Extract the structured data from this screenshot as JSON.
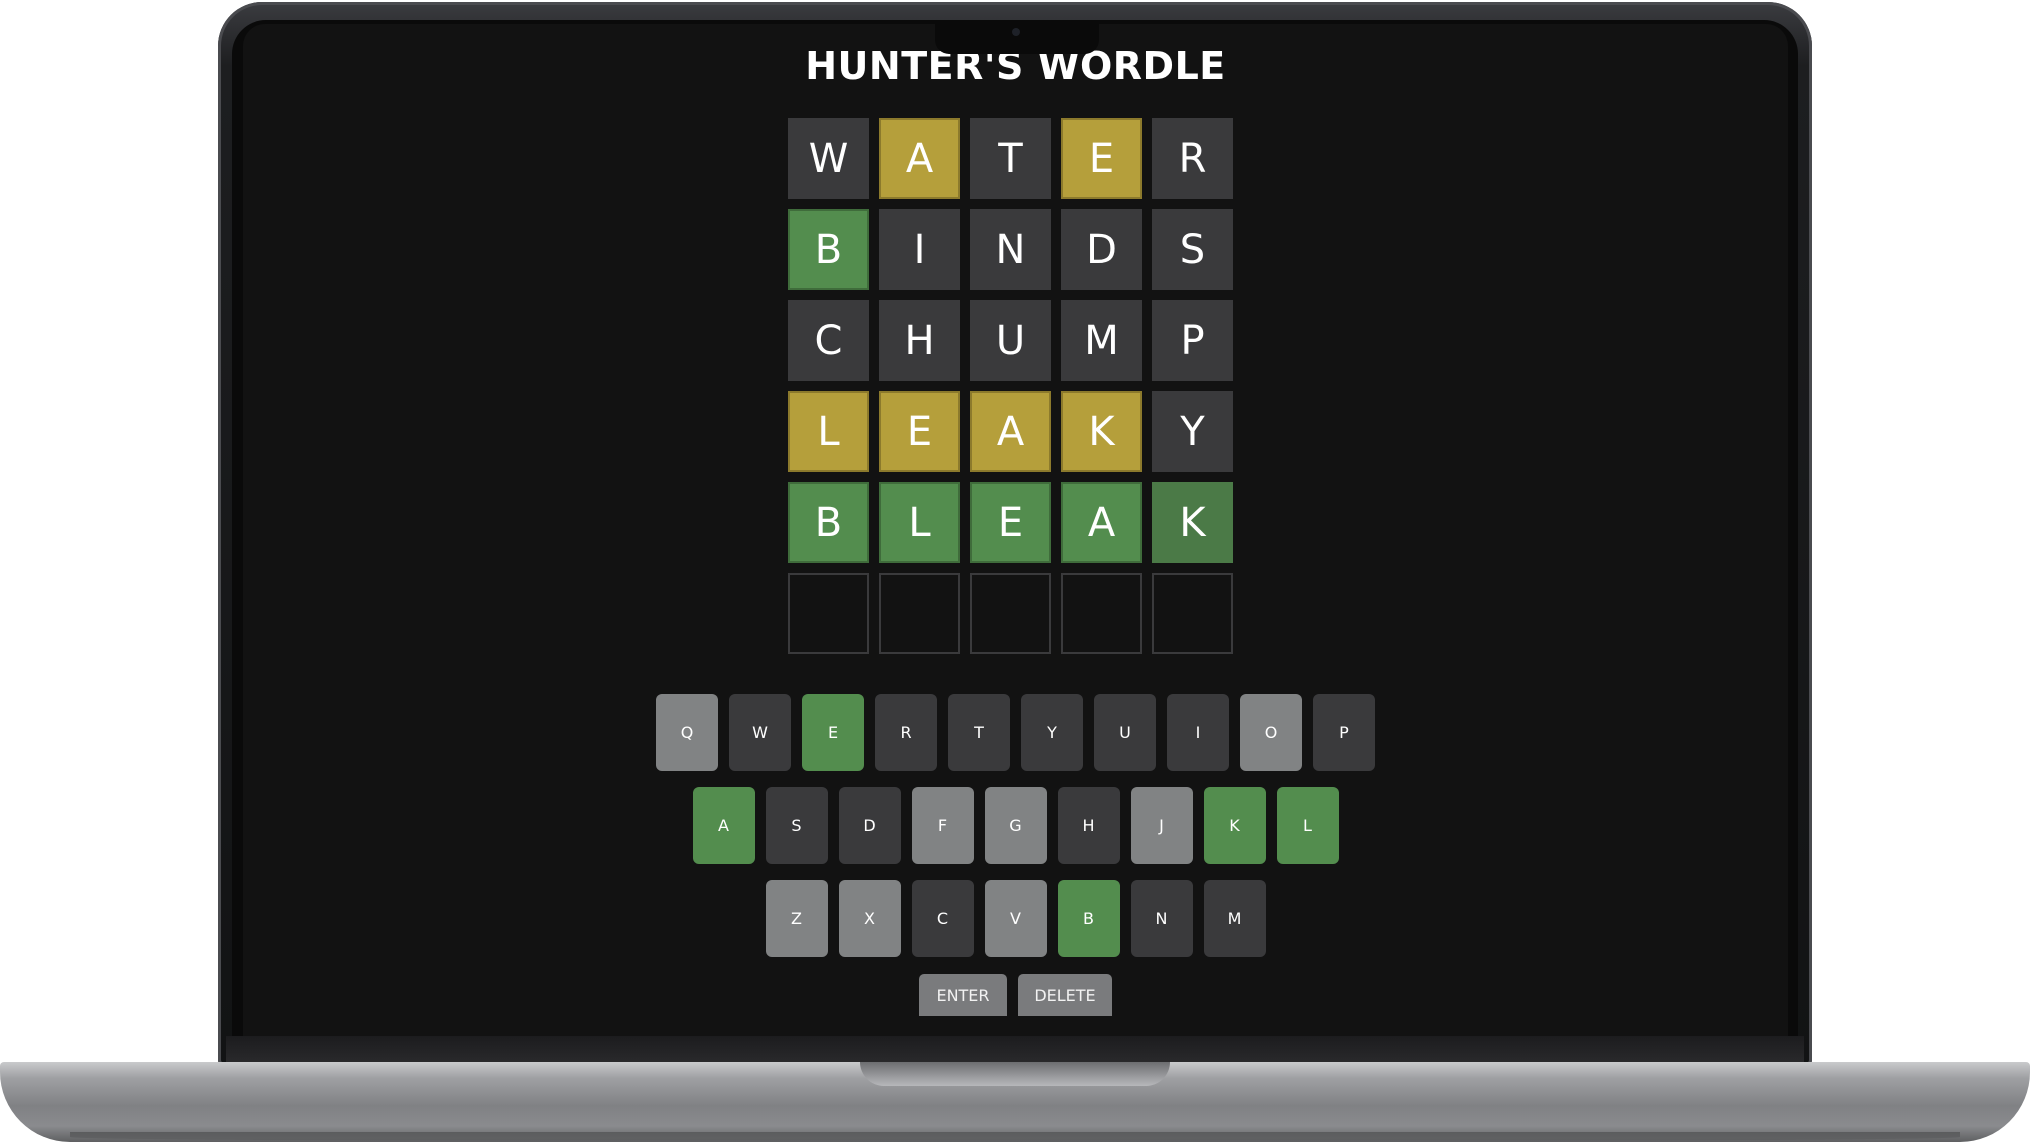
{
  "app": {
    "title": "HUNTER'S WORDLE"
  },
  "board": {
    "rows": [
      [
        {
          "l": "W",
          "s": "absent"
        },
        {
          "l": "A",
          "s": "present"
        },
        {
          "l": "T",
          "s": "absent"
        },
        {
          "l": "E",
          "s": "present"
        },
        {
          "l": "R",
          "s": "absent"
        }
      ],
      [
        {
          "l": "B",
          "s": "correct"
        },
        {
          "l": "I",
          "s": "absent"
        },
        {
          "l": "N",
          "s": "absent"
        },
        {
          "l": "D",
          "s": "absent"
        },
        {
          "l": "S",
          "s": "absent"
        }
      ],
      [
        {
          "l": "C",
          "s": "absent"
        },
        {
          "l": "H",
          "s": "absent"
        },
        {
          "l": "U",
          "s": "absent"
        },
        {
          "l": "M",
          "s": "absent"
        },
        {
          "l": "P",
          "s": "absent"
        }
      ],
      [
        {
          "l": "L",
          "s": "present"
        },
        {
          "l": "E",
          "s": "present"
        },
        {
          "l": "A",
          "s": "present"
        },
        {
          "l": "K",
          "s": "present"
        },
        {
          "l": "Y",
          "s": "absent"
        }
      ],
      [
        {
          "l": "B",
          "s": "correct"
        },
        {
          "l": "L",
          "s": "correct"
        },
        {
          "l": "E",
          "s": "correct"
        },
        {
          "l": "A",
          "s": "correct"
        },
        {
          "l": "K",
          "s": "correct-dark"
        }
      ],
      [
        {
          "l": "",
          "s": "empty"
        },
        {
          "l": "",
          "s": "empty"
        },
        {
          "l": "",
          "s": "empty"
        },
        {
          "l": "",
          "s": "empty"
        },
        {
          "l": "",
          "s": "empty"
        }
      ]
    ]
  },
  "keyboard": {
    "rows": [
      [
        {
          "k": "Q",
          "s": "absent"
        },
        {
          "k": "W",
          "s": "unused"
        },
        {
          "k": "E",
          "s": "correct"
        },
        {
          "k": "R",
          "s": "unused"
        },
        {
          "k": "T",
          "s": "unused"
        },
        {
          "k": "Y",
          "s": "unused"
        },
        {
          "k": "U",
          "s": "unused"
        },
        {
          "k": "I",
          "s": "unused"
        },
        {
          "k": "O",
          "s": "absent"
        },
        {
          "k": "P",
          "s": "unused"
        }
      ],
      [
        {
          "k": "A",
          "s": "correct"
        },
        {
          "k": "S",
          "s": "unused"
        },
        {
          "k": "D",
          "s": "unused"
        },
        {
          "k": "F",
          "s": "absent"
        },
        {
          "k": "G",
          "s": "absent"
        },
        {
          "k": "H",
          "s": "unused"
        },
        {
          "k": "J",
          "s": "absent"
        },
        {
          "k": "K",
          "s": "correct"
        },
        {
          "k": "L",
          "s": "correct"
        }
      ],
      [
        {
          "k": "Z",
          "s": "absent"
        },
        {
          "k": "X",
          "s": "absent"
        },
        {
          "k": "C",
          "s": "unused"
        },
        {
          "k": "V",
          "s": "absent"
        },
        {
          "k": "B",
          "s": "correct"
        },
        {
          "k": "N",
          "s": "unused"
        },
        {
          "k": "M",
          "s": "unused"
        }
      ]
    ],
    "enter_label": "ENTER",
    "delete_label": "DELETE"
  },
  "colors": {
    "background": "#121212",
    "tile_absent": "#3a3a3c",
    "tile_present": "#b59f3b",
    "tile_correct": "#538d4e",
    "key_unused": "#3a3a3c",
    "key_absent": "#818384",
    "key_correct": "#538d4e"
  }
}
